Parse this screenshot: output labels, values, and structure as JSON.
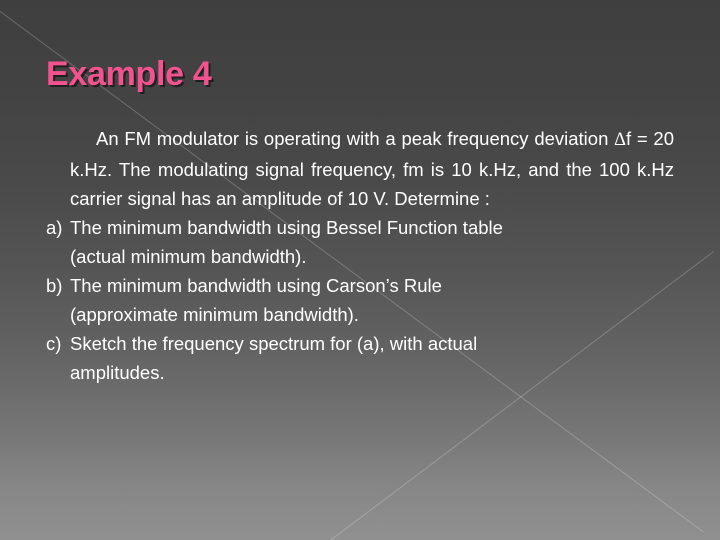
{
  "slide": {
    "title": "Example 4",
    "title_color": "#f2538f",
    "background_top_color": "#3f3f3f",
    "background_bottom_color": "#909090",
    "text_color": "#ffffff",
    "paragraph": {
      "line1": "An FM modulator is operating with a peak frequency",
      "line2_pre": "deviation ",
      "line2_delta": "Δ",
      "line2_post": "f = 20 k.Hz. The modulating signal frequency,",
      "line3": "fm is 10 k.Hz, and the 100 k.Hz carrier signal has an",
      "line4": "amplitude of 10 V. Determine :",
      "full": "An FM modulator is operating with a peak frequency deviation Δf = 20 k.Hz. The modulating signal frequency, fm is 10 k.Hz, and the 100 k.Hz carrier signal has an amplitude of 10 V. Determine :"
    },
    "items": [
      {
        "marker": "a)",
        "line1": "The minimum bandwidth using Bessel Function table",
        "line2": "(actual minimum bandwidth).",
        "full": "The minimum bandwidth using Bessel Function table (actual minimum bandwidth)."
      },
      {
        "marker": "b)",
        "line1": "The minimum bandwidth using Carson’s Rule",
        "line2": "(approximate minimum bandwidth).",
        "full": "The minimum bandwidth using Carson’s Rule (approximate minimum bandwidth)."
      },
      {
        "marker": "c)",
        "line1": "Sketch the frequency spectrum for (a), with actual",
        "line2": "amplitudes.",
        "full": "Sketch the frequency spectrum for (a), with actual amplitudes."
      }
    ]
  }
}
